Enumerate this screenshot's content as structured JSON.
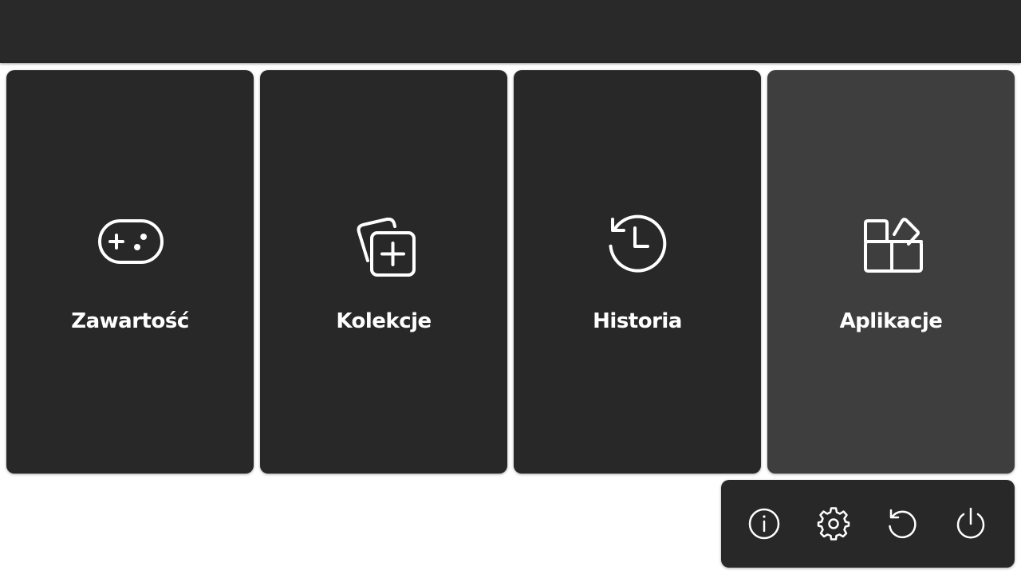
{
  "menu": {
    "tiles": [
      {
        "label": "Zawartość",
        "icon": "gamepad-icon"
      },
      {
        "label": "Kolekcje",
        "icon": "add-collection-icon"
      },
      {
        "label": "Historia",
        "icon": "history-icon"
      },
      {
        "label": "Aplikacje",
        "icon": "apps-icon"
      }
    ],
    "selected_tile": "Aplikacje"
  },
  "system_buttons": [
    {
      "icon": "info-icon"
    },
    {
      "icon": "settings-gear-icon"
    },
    {
      "icon": "restart-icon"
    },
    {
      "icon": "power-icon"
    }
  ],
  "colors": {
    "topbar": "#292929",
    "tile": "#282828",
    "tile_selected": "#3e3e3e",
    "text": "#ffffff",
    "background": "#ffffff"
  }
}
